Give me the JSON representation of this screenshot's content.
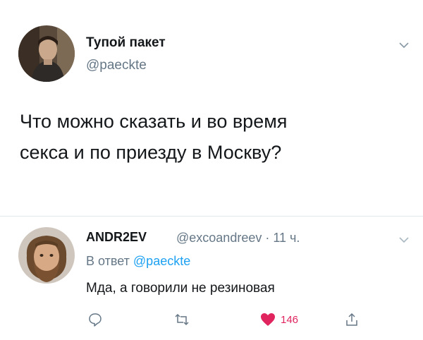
{
  "tweet": {
    "author_name": "Тупой пакет",
    "author_handle": "@paeckte",
    "text_line1": "Что можно сказать и во время",
    "text_line2": "секса и по приезду в Москву?"
  },
  "reply": {
    "author_name": "ANDR2EV",
    "meta": "@excoandreev · 11 ч.",
    "reply_to_prefix": "В ответ",
    "reply_to_handle": "@paeckte",
    "text": "Мда, а говорили не резиновая",
    "like_count": "146"
  },
  "colors": {
    "accent": "#1da1f2",
    "like": "#e0245e",
    "secondary_text": "#657786"
  },
  "icons": [
    "chevron-down-icon",
    "reply-icon",
    "retweet-icon",
    "heart-icon",
    "share-icon"
  ]
}
